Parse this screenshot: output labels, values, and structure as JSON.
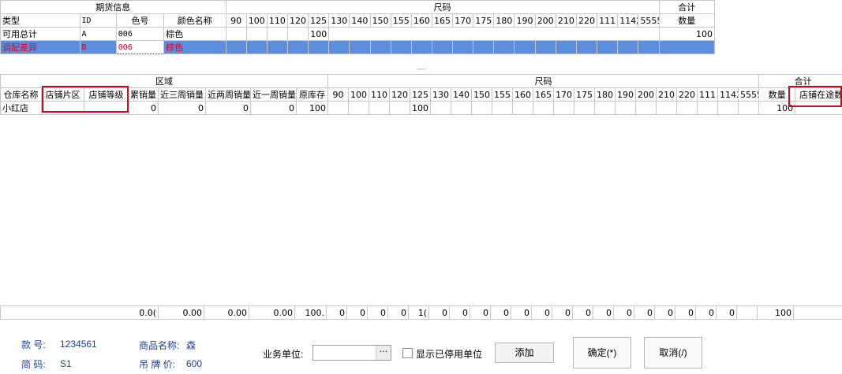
{
  "top_grid": {
    "group_headers": [
      "期货信息",
      "尺码",
      "合计"
    ],
    "columns": [
      "类型",
      "ID",
      "色号",
      "颜色名称"
    ],
    "sizes": [
      "90",
      "100",
      "110",
      "120",
      "125",
      "130",
      "140",
      "150",
      "155",
      "160",
      "165",
      "170",
      "175",
      "180",
      "190",
      "200",
      "210",
      "220",
      "111",
      "1142",
      "5555"
    ],
    "total_col": "数量",
    "rows": [
      {
        "type": "可用总计",
        "id": "A",
        "code": "006",
        "color": "棕色",
        "s125": "100",
        "total": "100"
      },
      {
        "type": "调配差异",
        "id": "B",
        "code": "006",
        "color": "棕色",
        "s125": "",
        "total": ""
      }
    ]
  },
  "splitter": "····",
  "bottom_grid": {
    "group_headers": [
      "区域",
      "尺码",
      "合计"
    ],
    "columns": [
      "仓库名称",
      "店铺片区",
      "店铺等级",
      "累销量",
      "近三周销量",
      "近两周销量",
      "近一周销量",
      "原库存"
    ],
    "sizes": [
      "90",
      "100",
      "110",
      "120",
      "125",
      "130",
      "140",
      "150",
      "155",
      "160",
      "165",
      "170",
      "175",
      "180",
      "190",
      "200",
      "210",
      "220",
      "111",
      "1142",
      "5555"
    ],
    "total_cols": [
      "数量",
      "店铺在途数"
    ],
    "rows": [
      {
        "store": "小红店",
        "region": "",
        "level": "",
        "cum": "0",
        "w3": "0",
        "w2": "0",
        "w1": "0",
        "stock": "100",
        "s125": "100",
        "qty": "100",
        "transit": ""
      }
    ]
  },
  "totals_row": [
    "0.0(",
    "0.00",
    "0.00",
    "0.00",
    "100.",
    "0",
    "0",
    "0",
    "0",
    "1(",
    "0",
    "0",
    "0",
    "0",
    "0",
    "0",
    "0",
    "0",
    "0",
    "0",
    "0",
    "0",
    "0",
    "0",
    "0",
    "100"
  ],
  "footer": {
    "style_label": "款  号:",
    "style_value": "1234561",
    "short_code_label": "简  码:",
    "short_code_value": "S1",
    "product_name_label": "商品名称:",
    "product_name_value": "森",
    "tag_price_label": "吊 牌 价:",
    "tag_price_value": "600",
    "business_unit_label": "业务单位:",
    "business_unit_value": "",
    "ellipsis": "···",
    "show_disabled_label": "显示已停用单位",
    "add_button": "添加",
    "confirm_button": "确定(*)",
    "cancel_button": "取消(/)"
  }
}
